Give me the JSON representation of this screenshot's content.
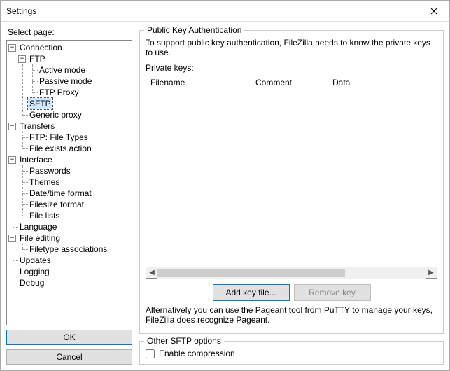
{
  "window": {
    "title": "Settings"
  },
  "left": {
    "select_label": "Select page:",
    "ok_label": "OK",
    "cancel_label": "Cancel"
  },
  "tree": {
    "connection": "Connection",
    "ftp": "FTP",
    "active_mode": "Active mode",
    "passive_mode": "Passive mode",
    "ftp_proxy": "FTP Proxy",
    "sftp": "SFTP",
    "generic_proxy": "Generic proxy",
    "transfers": "Transfers",
    "ftp_file_types": "FTP: File Types",
    "file_exists": "File exists action",
    "interface": "Interface",
    "passwords": "Passwords",
    "themes": "Themes",
    "datetime": "Date/time format",
    "filesize": "Filesize format",
    "file_lists": "File lists",
    "language": "Language",
    "file_editing": "File editing",
    "filetype_assoc": "Filetype associations",
    "updates": "Updates",
    "logging": "Logging",
    "debug": "Debug"
  },
  "main": {
    "group1_title": "Public Key Authentication",
    "description": "To support public key authentication, FileZilla needs to know the private keys to use.",
    "private_keys_label": "Private keys:",
    "columns": {
      "filename": "Filename",
      "comment": "Comment",
      "data": "Data"
    },
    "add_key_label": "Add key file...",
    "remove_key_label": "Remove key",
    "alt_text": "Alternatively you can use the Pageant tool from PuTTY to manage your keys, FileZilla does recognize Pageant.",
    "group2_title": "Other SFTP options",
    "enable_compression_label": "Enable compression"
  }
}
